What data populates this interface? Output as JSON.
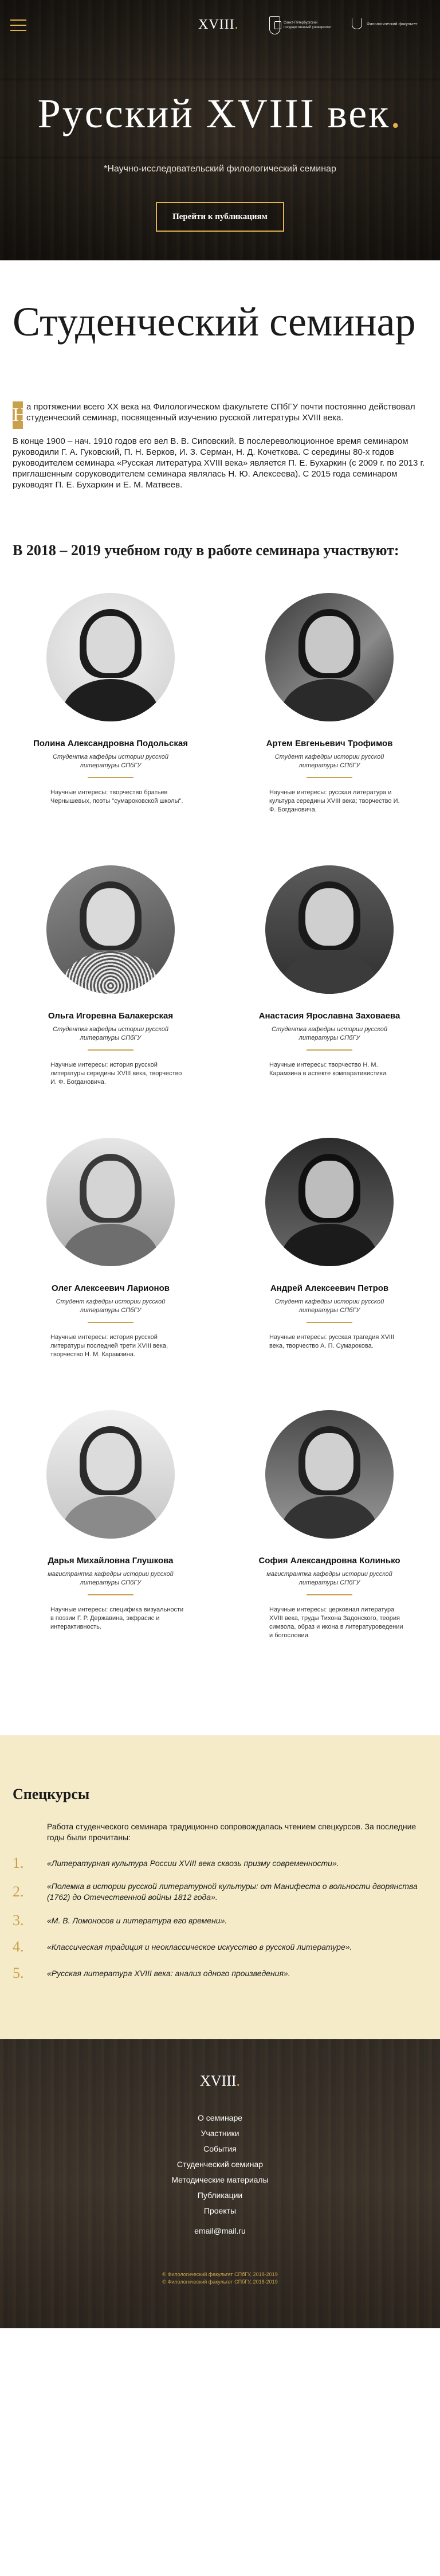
{
  "header": {
    "logo": "XVIII",
    "logo_dot": ".",
    "university_text": "Санкт-Петербургский государственный университет",
    "faculty_text": "Филологический факультет"
  },
  "hero": {
    "title": "Русский XVIII век",
    "title_dot": ".",
    "subtitle": "*Научно-исследовательский филологический семинар",
    "button": "Перейти к публикациям"
  },
  "seminar": {
    "title": "Студенческий семинар",
    "dropcap": "Н",
    "intro": "а протяжении всего XX века на Филологическом факультете СПбГУ почти постоянно действовал студенческий семинар, посвященный изучению русской литературы XVIII века.",
    "history": "В конце 1900 – нач. 1910 годов его вел В. В. Сиповский. В послереволюционное время семинаром руководили Г. А. Гуковский, П. Н. Берков, И. З. Серман, Н. Д. Кочеткова. С середины 80-х годов руководителем семинара «Русская литература XVIII века» является П. Е. Бухаркин (с 2009 г. по 2013 г. приглашенным соруководителем семинара являлась Н. Ю. Алексеева). С 2015 года семинаром руководят П. Е. Бухаркин и Е. М. Матвеев.",
    "participants_title": "В 2018 – 2019 учебном году в работе семинара участвуют:"
  },
  "participants": [
    {
      "name": "Полина Александровна Подольская",
      "role": "Студентка кафедры истории русской литературы СПбГУ",
      "interests": "Научные интересы: творчество братьев Чернышевых, поэты \"сумароковской школы\"."
    },
    {
      "name": "Артем Евгеньевич Трофимов",
      "role": "Студент кафедры истории русской литературы СПбГУ",
      "interests": "Научные интересы: русская литература и культура середины XVIII века; творчество И. Ф. Богдановича."
    },
    {
      "name": "Ольга Игоревна Балакерская",
      "role": "Студентка кафедры истории русской литературы СПбГУ",
      "interests": "Научные интересы: история русской литературы середины XVIII века, творчество И. Ф. Богдановича."
    },
    {
      "name": "Анастасия Ярославна Заховаева",
      "role": "Студентка кафедры истории русской литературы СПбГУ",
      "interests": "Научные интересы: творчество Н. М. Карамзина в аспекте компаративистики."
    },
    {
      "name": "Олег Алексеевич Ларионов",
      "role": "Студент кафедры истории русской литературы СПбГУ",
      "interests": "Научные интересы: история русской литературы последней трети XVIII века, творчество Н. М. Карамзина."
    },
    {
      "name": "Андрей Алексеевич Петров",
      "role": "Студент кафедры истории русской литературы СПбГУ",
      "interests": "Научные интересы: русская трагедия XVIII века, творчество А. П. Сумарокова."
    },
    {
      "name": "Дарья Михайловна Глушкова",
      "role": "магистрантка кафедры истории русской литературы СПбГУ",
      "interests": "Научные интересы: специфика визуальности в поэзии Г. Р. Державина, экфрасис и интерактивность."
    },
    {
      "name": "София Александровна Колинько",
      "role": "магистрантка кафедры истории русской литературы СПбГУ",
      "interests": "Научные интересы: церковная литература XVIII века, труды Тихона Задонского, теория символа, образ и икона в литературоведении и богословии."
    }
  ],
  "special": {
    "title": "Спецкурсы",
    "lead": "Работа студенческого семинара традиционно сопровождалась чтением спецкурсов. За последние годы были прочитаны:",
    "courses": [
      {
        "num": "1.",
        "text": "«Литературная культура России XVIII века сквозь призму современности»."
      },
      {
        "num": "2.",
        "text": "«Полемка в истории русской литературной культуры: от Манифеста о вольности дворянства (1762) до Отечественной войны 1812 года»."
      },
      {
        "num": "3.",
        "text": "«М. В. Ломоносов и литература его времени»."
      },
      {
        "num": "4.",
        "text": "«Классическая традиция и неоклассическое искусство в русской литературе»."
      },
      {
        "num": "5.",
        "text": "«Русская литература XVIII века: анализ одного произведения»."
      }
    ]
  },
  "footer": {
    "logo": "XVIII",
    "logo_dot": ".",
    "nav": [
      "О семинаре",
      "Участники",
      "События",
      "Студенческий семинар",
      "Методические материалы",
      "Публикации",
      "Проекты"
    ],
    "email": "email@mail.ru",
    "copyright_1": "© Филологический факультет СПбГУ, 2018-2019",
    "copyright_2": "© Филологический факультет СПбГУ, 2018-2019"
  },
  "colors": {
    "accent": "#e0b34f",
    "gold": "#c9a04c",
    "special_bg": "#f5ebc9",
    "dark": "#2e2924"
  }
}
